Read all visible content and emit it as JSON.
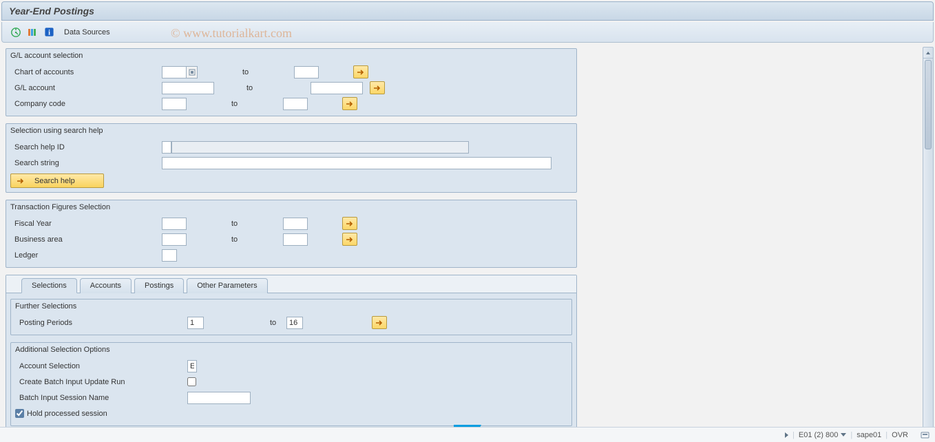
{
  "title": "Year-End Postings",
  "toolbar": {
    "data_sources": "Data Sources"
  },
  "watermark": "© www.tutorialkart.com",
  "group_gl": {
    "title": "G/L account selection",
    "chart_of_accounts": "Chart of accounts",
    "gl_account": "G/L account",
    "company_code": "Company code",
    "to": "to"
  },
  "group_search": {
    "title": "Selection using search help",
    "search_help_id": "Search help ID",
    "search_string": "Search string",
    "button": "Search help"
  },
  "group_trans": {
    "title": "Transaction Figures Selection",
    "fiscal_year": "Fiscal Year",
    "business_area": "Business area",
    "ledger": "Ledger",
    "to": "to"
  },
  "tabs": [
    "Selections",
    "Accounts",
    "Postings",
    "Other Parameters"
  ],
  "further": {
    "title": "Further Selections",
    "posting_periods": "Posting Periods",
    "pp_from": "1",
    "pp_to": "16",
    "to": "to"
  },
  "addsel": {
    "title": "Additional Selection Options",
    "account_selection": "Account Selection",
    "account_selection_val": "E",
    "create_batch": "Create Batch Input Update Run",
    "session_name": "Batch Input Session Name",
    "hold_session": "Hold processed session"
  },
  "status": {
    "system": "E01 (2) 800",
    "appserver": "sape01",
    "mode": "OVR"
  }
}
